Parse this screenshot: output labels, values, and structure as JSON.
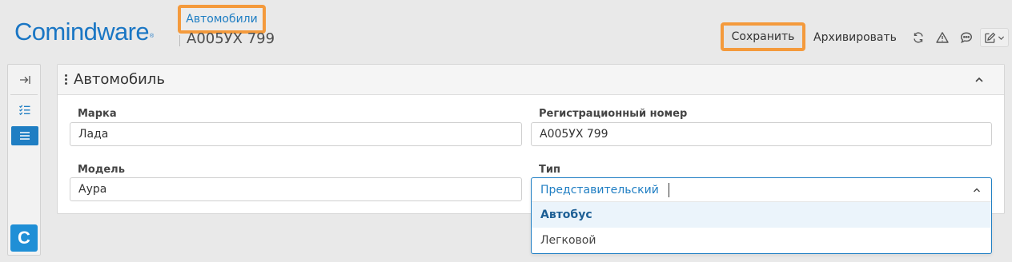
{
  "app": {
    "logo_text": "Comindware",
    "logo_mark": "®"
  },
  "breadcrumb": {
    "label": "Автомобили"
  },
  "page": {
    "title": "А005УХ 799"
  },
  "toolbar": {
    "save_label": "Сохранить",
    "archive_label": "Архивировать",
    "icons": [
      "refresh-icon",
      "warning-icon",
      "comment-icon",
      "edit-icon"
    ]
  },
  "rail": {
    "logo_letter": "C"
  },
  "panel": {
    "title": "Автомобиль"
  },
  "form": {
    "brand": {
      "label": "Марка",
      "value": "Лада"
    },
    "reg_number": {
      "label": "Регистрационный номер",
      "value": "А005УХ 799"
    },
    "model": {
      "label": "Модель",
      "value": "Аура"
    },
    "type": {
      "label": "Тип",
      "value": "Представительский",
      "options": [
        "Автобус",
        "Легковой"
      ]
    }
  },
  "colors": {
    "accent": "#1f7ec3",
    "highlight_border": "#f49a3c",
    "logo": "#1a76c4"
  }
}
